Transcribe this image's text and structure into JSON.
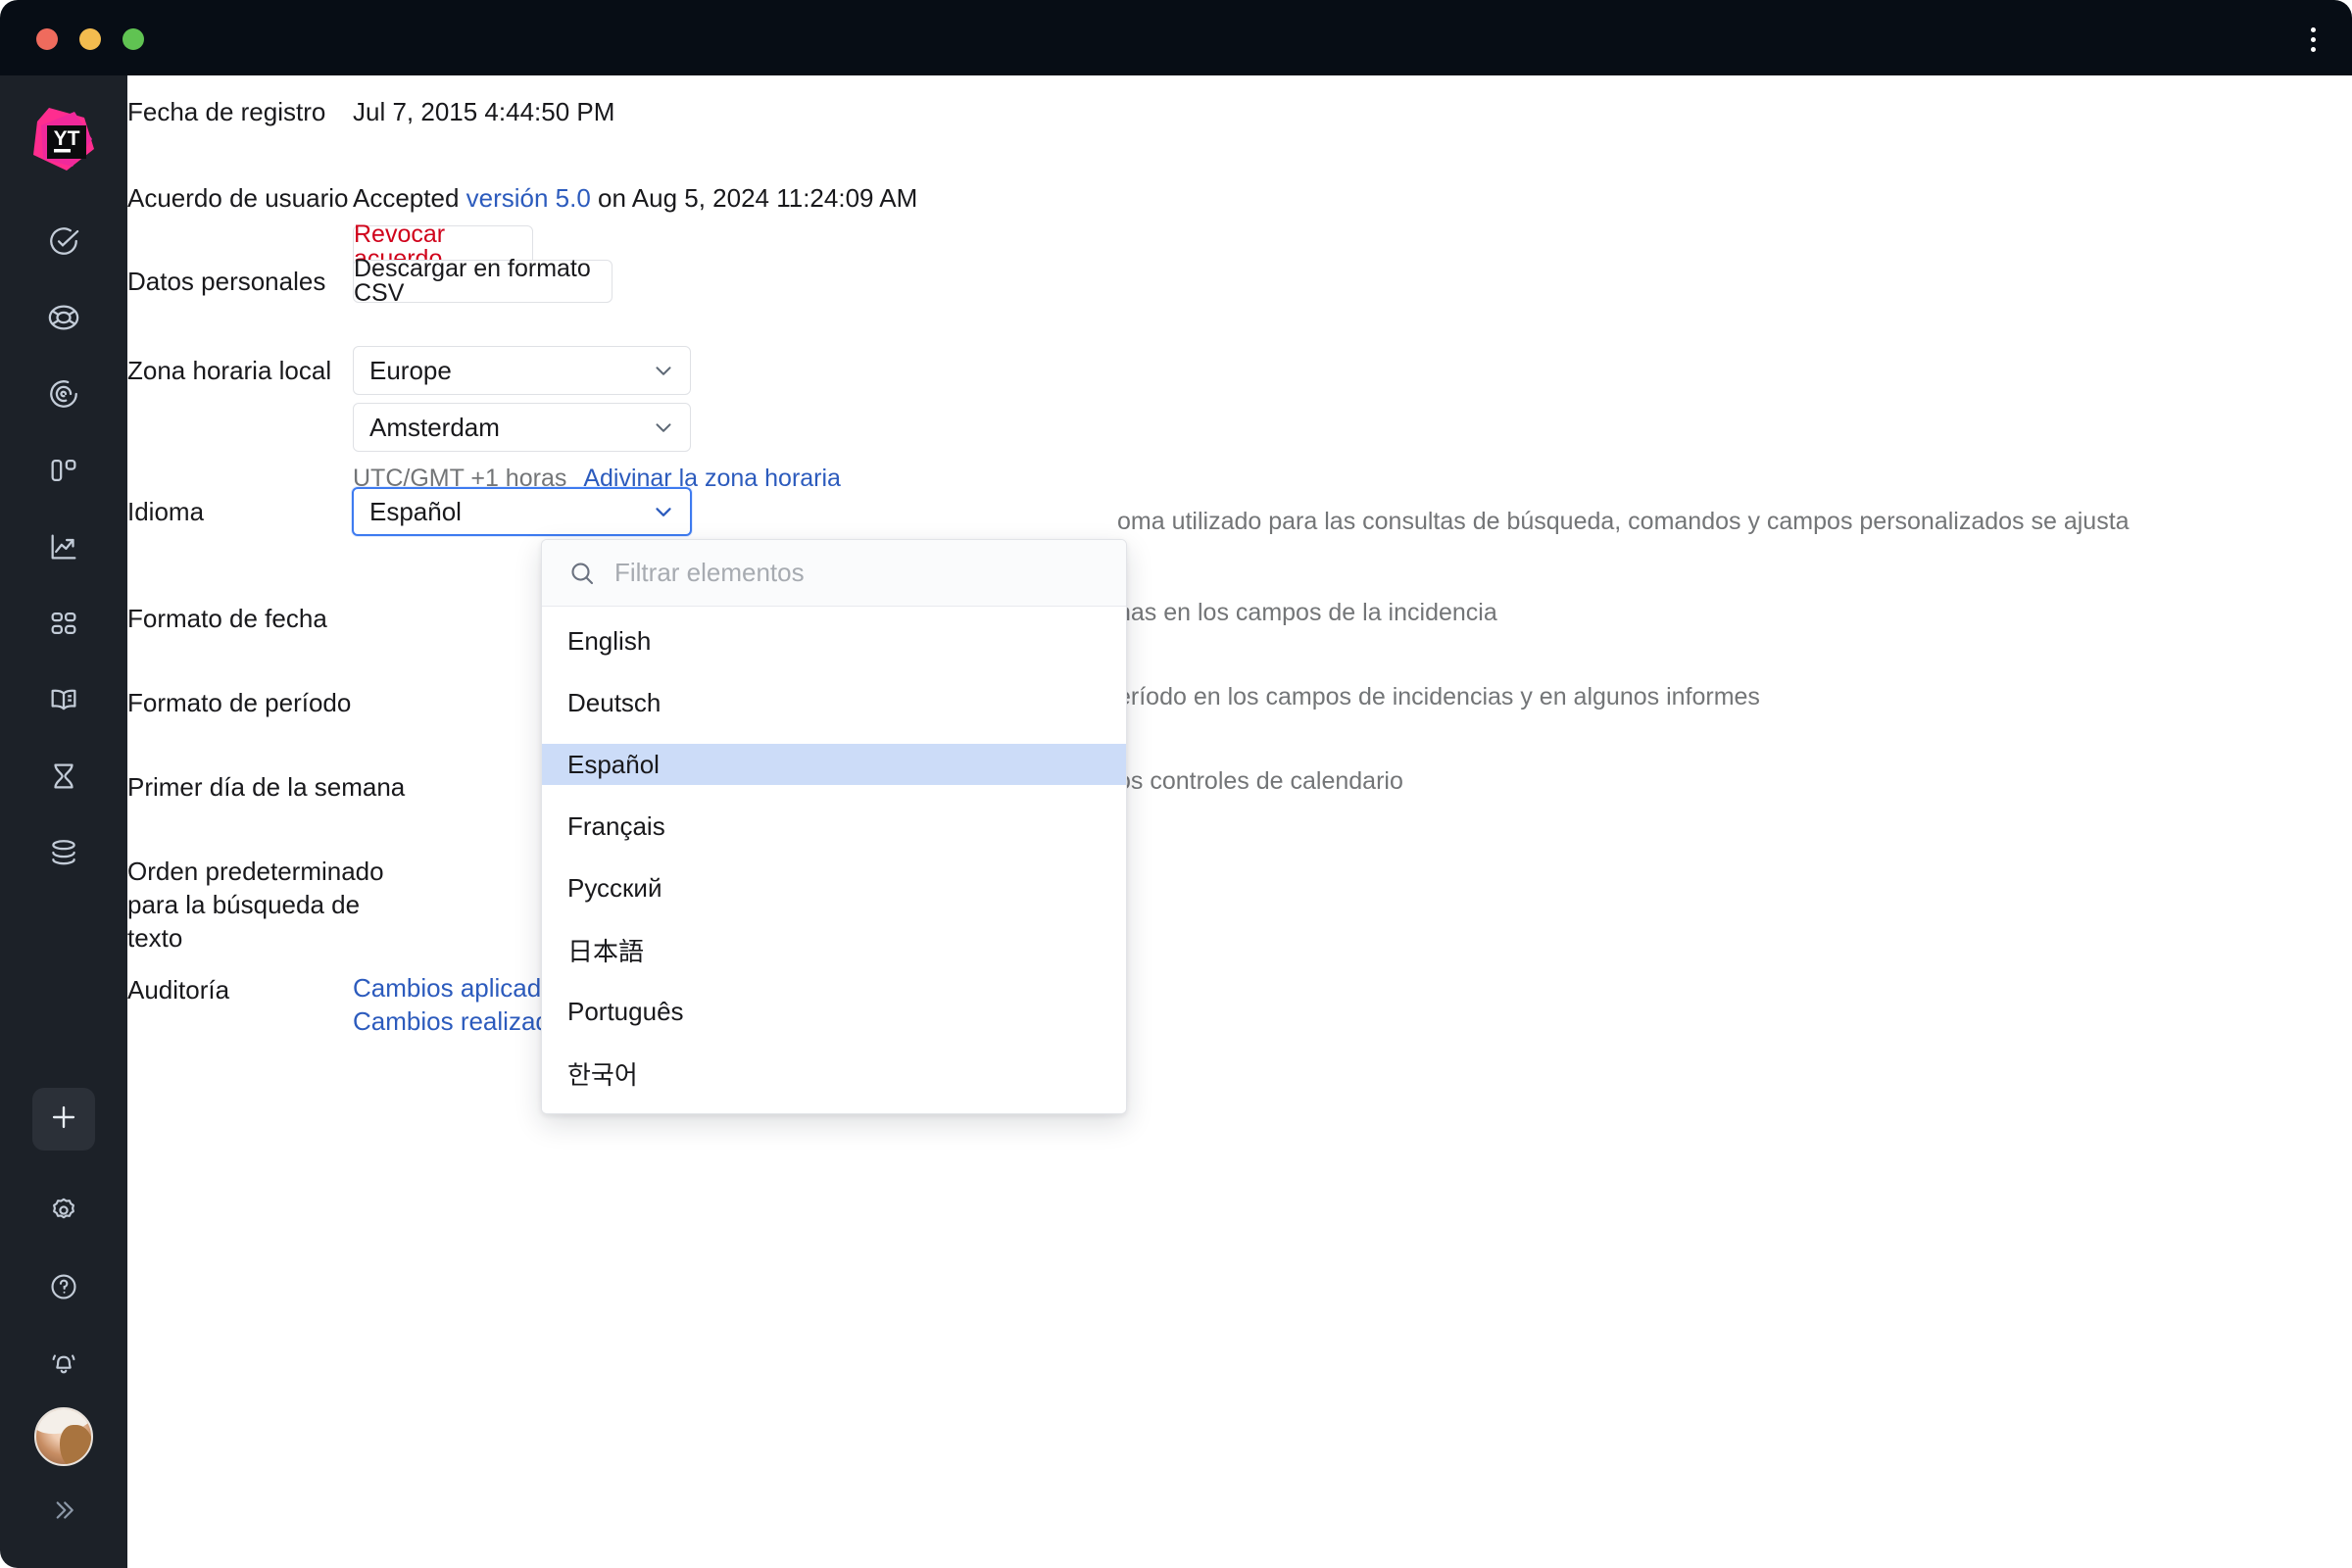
{
  "window": {
    "traffic_lights": [
      "close",
      "minimize",
      "maximize"
    ],
    "menu_icon": "kebab-menu-icon"
  },
  "sidebar": {
    "logo": "youtrack-logo",
    "items": [
      {
        "icon": "check-circle-icon",
        "name": "issues"
      },
      {
        "icon": "lifebuoy-icon",
        "name": "helpdesk"
      },
      {
        "icon": "radar-icon",
        "name": "agile-boards"
      },
      {
        "icon": "columns-icon",
        "name": "boards"
      },
      {
        "icon": "trend-up-icon",
        "name": "reports"
      },
      {
        "icon": "grid-apps-icon",
        "name": "dashboards"
      },
      {
        "icon": "book-open-icon",
        "name": "knowledge-base"
      },
      {
        "icon": "hourglass-icon",
        "name": "timesheets"
      },
      {
        "icon": "layers-icon",
        "name": "projects"
      }
    ],
    "bottom_items": [
      {
        "icon": "plus-icon",
        "name": "create"
      },
      {
        "icon": "gear-icon",
        "name": "settings"
      },
      {
        "icon": "question-circle-icon",
        "name": "help"
      },
      {
        "icon": "bell-icon",
        "name": "notifications"
      },
      {
        "icon": "avatar",
        "name": "user-avatar"
      },
      {
        "icon": "chevron-double-right-icon",
        "name": "expand-sidebar"
      }
    ]
  },
  "form": {
    "registration": {
      "label": "Fecha de registro",
      "value": "Jul 7, 2015 4:44:50 PM"
    },
    "agreement": {
      "label": "Acuerdo de usuario",
      "prefix": "Accepted ",
      "link": "versión 5.0",
      "suffix": " on Aug 5, 2024 11:24:09 AM",
      "revoke_button": "Revocar acuerdo"
    },
    "personal_data": {
      "label": "Datos personales",
      "download_button": "Descargar en formato CSV"
    },
    "timezone": {
      "label": "Zona horaria local",
      "region_value": "Europe",
      "city_value": "Amsterdam",
      "offset_text": "UTC/GMT +1 horas",
      "guess_link": "Adivinar la zona horaria"
    },
    "language": {
      "label": "Idioma",
      "value": "Español",
      "description": "oma utilizado para las consultas de búsqueda, comandos y campos personalizados se ajusta"
    },
    "date_format": {
      "label": "Formato de fecha",
      "description": "has en los campos de la incidencia"
    },
    "period_format": {
      "label": "Formato de período",
      "description": "eríodo en los campos de incidencias y en algunos informes"
    },
    "first_day": {
      "label": "Primer día de la semana",
      "description": "os controles de calendario"
    },
    "default_order": {
      "label": "Orden predeterminado para la búsqueda de texto"
    },
    "audit": {
      "label": "Auditoría",
      "links": [
        "Cambios aplicados a Carry Parker",
        "Cambios realizados por Carry Parker"
      ]
    }
  },
  "language_dropdown": {
    "search_placeholder": "Filtrar elementos",
    "search_value": "",
    "search_icon": "search-icon",
    "options": [
      "English",
      "Deutsch",
      "Español",
      "Français",
      "Русский",
      "日本語",
      "Português",
      "한국어"
    ],
    "selected": "Español"
  },
  "colors": {
    "accent_blue": "#2c5bbd",
    "focus_blue": "#3e7bf0",
    "danger_red": "#d0021b",
    "selected_row": "#ccdcf8",
    "rail_bg": "#1c2128",
    "titlebar_bg": "#070d15"
  }
}
